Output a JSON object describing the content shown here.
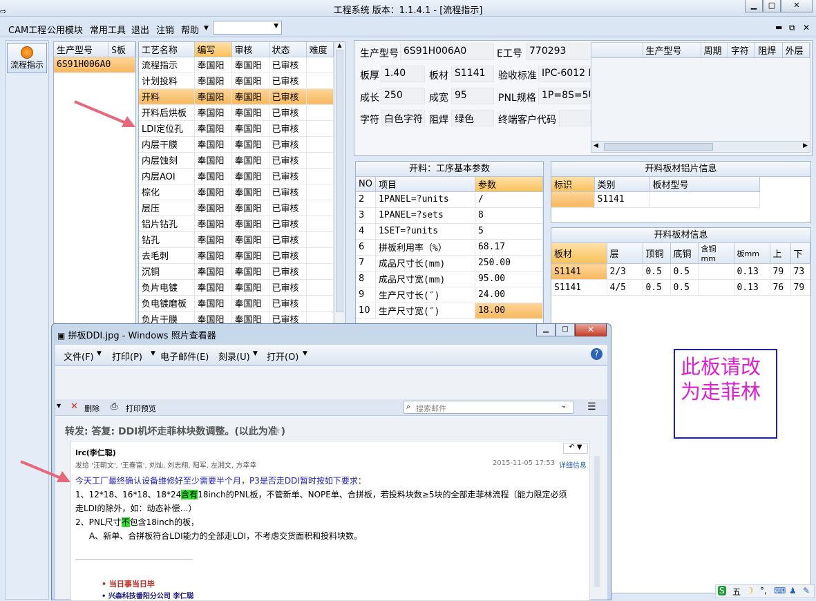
{
  "window": {
    "title": "工程系统  版本：1.1.4.1 - [流程指示]"
  },
  "menu": {
    "items": [
      "CAM工程",
      "公用模块",
      "常用工具",
      "退出",
      "注销",
      "帮助"
    ]
  },
  "left_button": {
    "label": "流程指示"
  },
  "product_list": {
    "headers": [
      "生产型号",
      "S板"
    ],
    "rows": [
      [
        "6S91H006A0",
        ""
      ]
    ]
  },
  "process_table": {
    "headers": [
      "工艺名称",
      "编写",
      "审核",
      "状态",
      "难度"
    ],
    "rows": [
      [
        "流程指示",
        "奉国阳",
        "奉国阳",
        "已审核"
      ],
      [
        "计划投料",
        "奉国阳",
        "奉国阳",
        "已审核"
      ],
      [
        "开料",
        "奉国阳",
        "奉国阳",
        "已审核"
      ],
      [
        "开料后烘板",
        "奉国阳",
        "奉国阳",
        "已审核"
      ],
      [
        "LDI定位孔",
        "奉国阳",
        "奉国阳",
        "已审核"
      ],
      [
        "内层干膜",
        "奉国阳",
        "奉国阳",
        "已审核"
      ],
      [
        "内层蚀刻",
        "奉国阳",
        "奉国阳",
        "已审核"
      ],
      [
        "内层AOI",
        "奉国阳",
        "奉国阳",
        "已审核"
      ],
      [
        "棕化",
        "奉国阳",
        "奉国阳",
        "已审核"
      ],
      [
        "层压",
        "奉国阳",
        "奉国阳",
        "已审核"
      ],
      [
        "铝片钻孔",
        "奉国阳",
        "奉国阳",
        "已审核"
      ],
      [
        "钻孔",
        "奉国阳",
        "奉国阳",
        "已审核"
      ],
      [
        "去毛刺",
        "奉国阳",
        "奉国阳",
        "已审核"
      ],
      [
        "沉铜",
        "奉国阳",
        "奉国阳",
        "已审核"
      ],
      [
        "负片电镀",
        "奉国阳",
        "奉国阳",
        "已审核"
      ],
      [
        "负电镀磨板",
        "奉国阳",
        "奉国阳",
        "已审核"
      ],
      [
        "负片干膜",
        "奉国阳",
        "奉国阳",
        "已审核"
      ]
    ]
  },
  "info": {
    "product_label": "生产型号",
    "product": "6S91H006A0",
    "eno_label": "E工号",
    "eno": "770293",
    "thick_label": "板厚",
    "thick": "1.40",
    "material_label": "板材",
    "material": "S1141",
    "standard_label": "验收标准",
    "standard": "IPC-6012 I",
    "len_label": "成长",
    "len": "250",
    "wid_label": "成宽",
    "wid": "95",
    "pnl_label": "PNL规格",
    "pnl": "1P=8S=5U",
    "char_label": "字符",
    "char": "白色字符",
    "mask_label": "阻焊",
    "mask": "绿色",
    "client_label": "终端客户代码"
  },
  "right_grid": {
    "headers": [
      "生产型号",
      "周期",
      "字符",
      "阻焊",
      "外层"
    ]
  },
  "params": {
    "title": "开料：工序基本参数",
    "headers": [
      "NO",
      "项目",
      "参数"
    ],
    "rows": [
      [
        "2",
        "1PANEL=?units",
        "/"
      ],
      [
        "3",
        "1PANEL=?sets",
        "8"
      ],
      [
        "4",
        "1SET=?units",
        "5"
      ],
      [
        "6",
        "拼板利用率（%）",
        "68.17"
      ],
      [
        "7",
        "成品尺寸长(mm)",
        "250.00"
      ],
      [
        "8",
        "成品尺寸宽(mm)",
        "95.00"
      ],
      [
        "9",
        "生产尺寸长(″)",
        "24.00"
      ],
      [
        "10",
        "生产尺寸宽(″)",
        "18.00"
      ]
    ]
  },
  "alu": {
    "title": "开料板材铝片信息",
    "headers": [
      "标识",
      "类别",
      "板材型号"
    ],
    "rows": [
      [
        "",
        "S1141",
        ""
      ]
    ]
  },
  "sheet": {
    "title": "开料板材信息",
    "headers": [
      "板材",
      "层",
      "顶铜",
      "底铜",
      "含铜mm",
      "板mm",
      "上",
      "下"
    ],
    "rows": [
      [
        "S1141",
        "2/3",
        "0.5",
        "0.5",
        "",
        "0.13",
        "79",
        "73"
      ],
      [
        "S1141",
        "4/5",
        "0.5",
        "0.5",
        "",
        "0.13",
        "76",
        "79"
      ]
    ]
  },
  "viewer": {
    "title": "拼板DDI.jpg - Windows 照片查看器",
    "menus": [
      "文件(F)",
      "打印(P)",
      "电子邮件(E)",
      "刻录(U)",
      "打开(O)"
    ],
    "delete": "删除",
    "print_preview": "打印预览",
    "search_placeholder": "搜索邮件",
    "subject": "转发: 答复: DDI机坏走菲林块数调整。(以此为准 )",
    "sender": "lrc(李仁聪)",
    "recipients": "发给 '汪朝文', '王春富', 刘灿, 刘志翔, 阳军, 左湘文, 方幸幸",
    "date": "2015-11-05 17:53",
    "details": "详细信息",
    "line1": "今天工厂最终确认设备维修好至少需要半个月，P3是否走DDI暂时按如下要求：",
    "line2a": "1、12*18、16*18、18*24",
    "line2hl": "含有",
    "line2b": "18inch的PNL板，不管新单、NOPE单、合拼板，若投料块数≥5块的全部走菲林流程（能力限定必须",
    "line3": "走LDI的除外，如：动态补偿…）",
    "line4a": "2、PNL尺寸",
    "line4hl": "不",
    "line4b": "包含18inch的板，",
    "line5": "A、新单、合拼板符合LDI能力的全部走LDI，不考虑交货面积和投料块数。",
    "sig1": "当日事当日毕",
    "sig2": "兴森科技番阳分公司   李仁聪"
  },
  "note": {
    "text": "此板请改为走菲林"
  },
  "colors": {
    "arrow": "#e8687a",
    "note_border": "#1b1bd6",
    "note_text": "#e020d0",
    "selected": "#f6b85e"
  }
}
